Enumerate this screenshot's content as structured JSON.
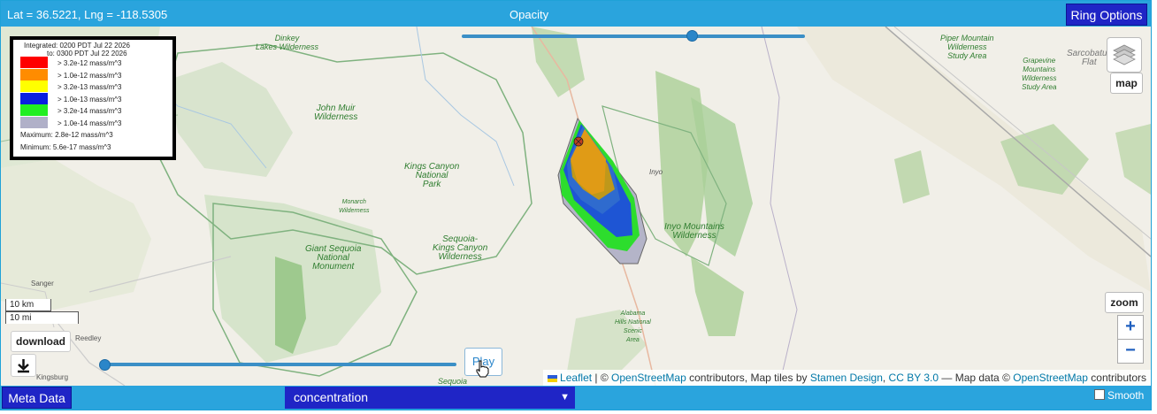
{
  "header": {
    "coords": "Lat = 36.5221, Lng = -118.5305",
    "opacity_label": "Opacity",
    "ring_options_label": "Ring Options"
  },
  "legend": {
    "integrated_line1": "Integrated: 0200 PDT Jul 22 2026",
    "integrated_line2": "to: 0300 PDT Jul 22 2026",
    "entries": [
      {
        "label": "> 3.2e-12 mass/m^3",
        "color": "#ff0000"
      },
      {
        "label": "> 1.0e-12 mass/m^3",
        "color": "#ff8c00"
      },
      {
        "label": "> 3.2e-13 mass/m^3",
        "color": "#ffff00"
      },
      {
        "label": "> 1.0e-13 mass/m^3",
        "color": "#0a1fe0"
      },
      {
        "label": "> 3.2e-14 mass/m^3",
        "color": "#22ee22"
      },
      {
        "label": "> 1.0e-14 mass/m^3",
        "color": "#b0b0c8"
      }
    ],
    "maximum": "Maximum: 2.8e-12  mass/m^3",
    "minimum": "Minimum: 5.6e-17  mass/m^3"
  },
  "map": {
    "places": [
      {
        "name": "Dinkey Lakes Wilderness",
        "lines": [
          "Dinkey",
          "Lakes Wilderness"
        ]
      },
      {
        "name": "John Muir Wilderness",
        "lines": [
          "John Muir",
          "Wilderness"
        ]
      },
      {
        "name": "Kings Canyon National Park",
        "lines": [
          "Kings Canyon",
          "National",
          "Park"
        ]
      },
      {
        "name": "Monarch Wilderness",
        "lines": [
          "Monarch",
          "Wilderness"
        ]
      },
      {
        "name": "Giant Sequoia National Monument",
        "lines": [
          "Giant Sequoia",
          "National",
          "Monument"
        ]
      },
      {
        "name": "Sequoia-Kings Canyon Wilderness",
        "lines": [
          "Sequoia-",
          "Kings Canyon",
          "Wilderness"
        ]
      },
      {
        "name": "Inyo Mountains Wilderness",
        "lines": [
          "Inyo Mountains",
          "Wilderness"
        ]
      },
      {
        "name": "Piper Mountain Wilderness Study Area",
        "lines": [
          "Piper Mountain",
          "Wilderness",
          "Study Area"
        ]
      },
      {
        "name": "Grapevine Mountains Wilderness Study Area",
        "lines": [
          "Grapevine",
          "Mountains",
          "Wilderness",
          "Study Area"
        ]
      },
      {
        "name": "Sarcobatus Flat",
        "lines": [
          "Sarcobatus",
          "Flat"
        ]
      },
      {
        "name": "Alabama Hills National Scenic Area",
        "lines": [
          "Alabama",
          "Hills National",
          "Scenic",
          "Area"
        ]
      },
      {
        "name": "Inyo",
        "lines": [
          "Inyo"
        ]
      },
      {
        "name": "Sanger",
        "lines": [
          "Sanger"
        ]
      },
      {
        "name": "Reedley",
        "lines": [
          "Reedley"
        ]
      },
      {
        "name": "Kingsburg",
        "lines": [
          "Kingsburg"
        ]
      },
      {
        "name": "Sequoia",
        "lines": [
          "Sequoia"
        ]
      }
    ],
    "opacity_level": 0.67,
    "time_level": 0.0
  },
  "controls": {
    "layers_icon": "layers-icon",
    "map_label": "map",
    "zoom_label": "zoom",
    "zoom_in": "+",
    "zoom_out": "−",
    "scale_km": "10 km",
    "scale_mi": "10 mi",
    "download_label": "download",
    "download_icon": "download-icon",
    "play_label": "Play"
  },
  "attribution": {
    "leaflet": "Leaflet",
    "sep1": " | © ",
    "osm1": "OpenStreetMap",
    "text1": " contributors, Map tiles by ",
    "stamen": "Stamen Design",
    "comma": ", ",
    "ccby": "CC BY 3.0",
    "text2": " — Map data © ",
    "osm2": "OpenStreetMap",
    "text3": " contributors"
  },
  "footer": {
    "meta_data_label": "Meta Data",
    "select_value": "concentration",
    "smooth_label": "Smooth",
    "smooth_checked": false
  }
}
